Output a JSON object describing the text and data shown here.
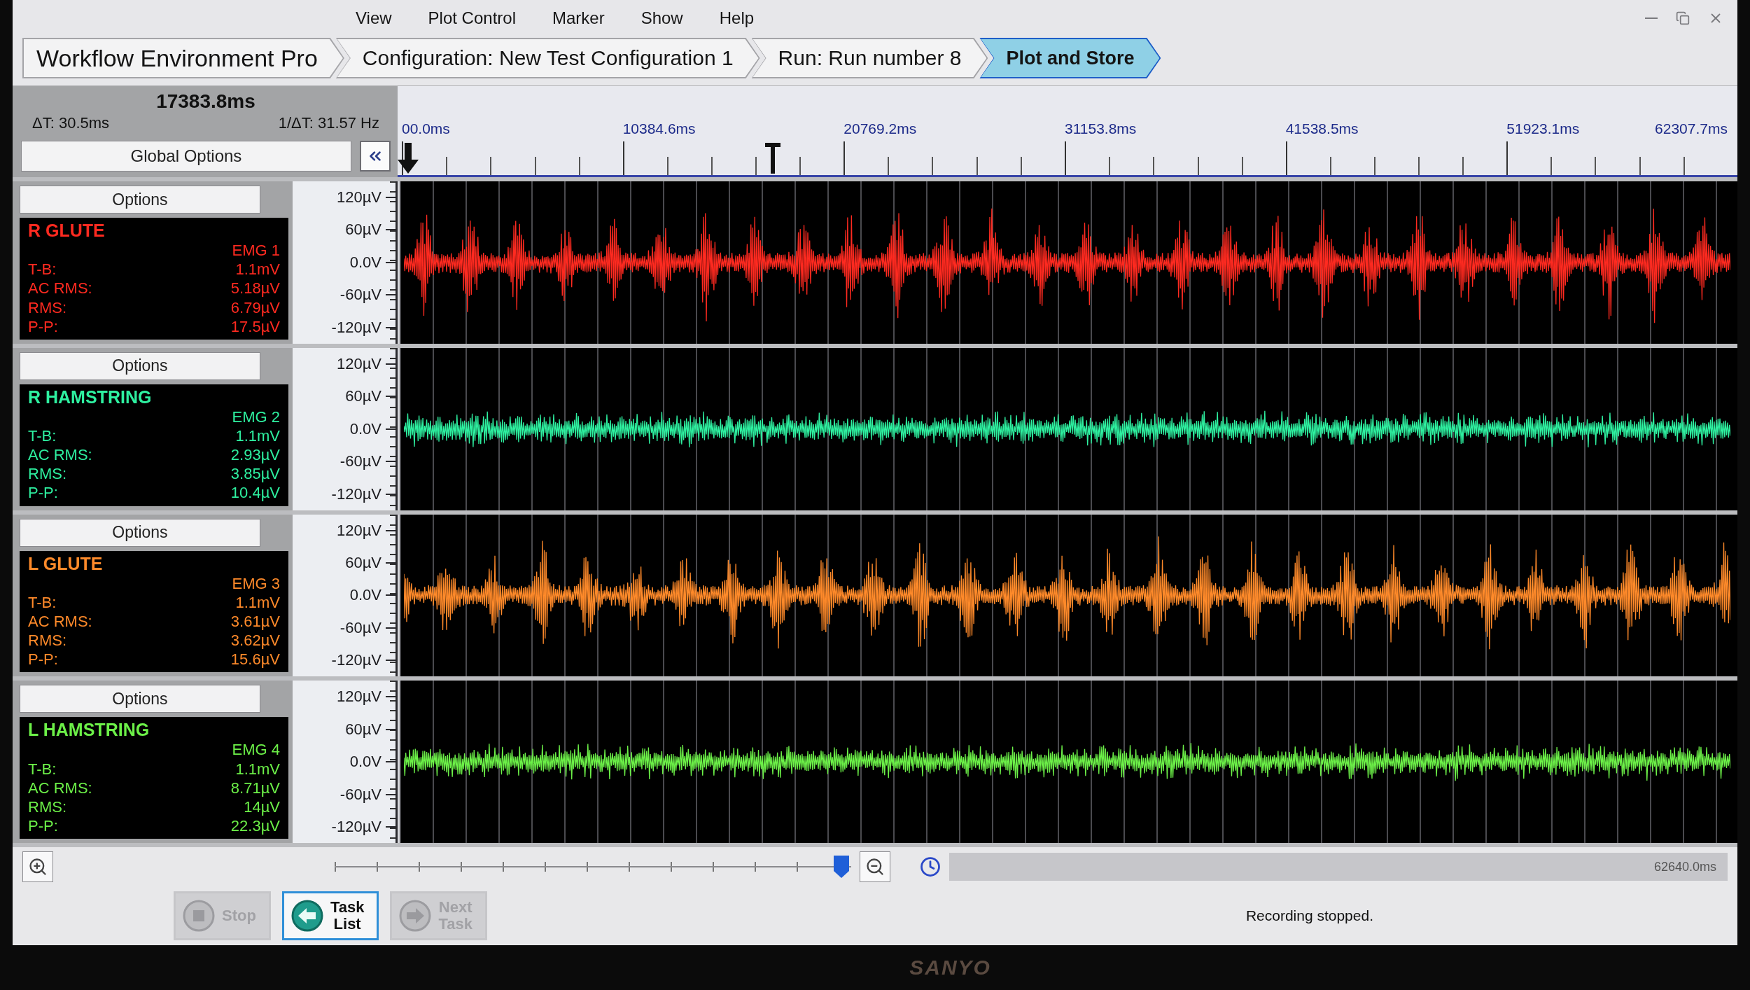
{
  "menu": [
    "View",
    "Plot Control",
    "Marker",
    "Show",
    "Help"
  ],
  "breadcrumbs": [
    {
      "label": "Workflow Environment Pro",
      "selected": false
    },
    {
      "label": "Configuration: New Test Configuration 1",
      "selected": false
    },
    {
      "label": "Run: Run number 8",
      "selected": false
    },
    {
      "label": "Plot and Store",
      "selected": true
    }
  ],
  "time_readout": {
    "time": "17383.8ms",
    "delta": "ΔT: 30.5ms",
    "frequency": "1/ΔT: 31.57 Hz",
    "global_options": "Global Options"
  },
  "ruler": {
    "labels": [
      "00.0ms",
      "10384.6ms",
      "20769.2ms",
      "31153.8ms",
      "41538.5ms",
      "51923.1ms",
      "62307.7ms"
    ],
    "cursor": {
      "level": 0.28
    }
  },
  "channels": [
    {
      "options": "Options",
      "name": "R GLUTE",
      "channel": "EMG 1",
      "color": "#ff2a20",
      "kind": "bursts",
      "stats": [
        {
          "label": "T-B:",
          "value": "1.1mV"
        },
        {
          "label": "AC RMS:",
          "value": "5.18µV"
        },
        {
          "label": "RMS:",
          "value": "6.79µV"
        },
        {
          "label": "P-P:",
          "value": "17.5µV"
        }
      ],
      "axis": [
        "120µV",
        "60µV",
        "0.0V",
        "-60µV",
        "-120µV"
      ]
    },
    {
      "options": "Options",
      "name": "R HAMSTRING",
      "channel": "EMG 2",
      "color": "#2ef0a0",
      "kind": "noise",
      "stats": [
        {
          "label": "T-B:",
          "value": "1.1mV"
        },
        {
          "label": "AC RMS:",
          "value": "2.93µV"
        },
        {
          "label": "RMS:",
          "value": "3.85µV"
        },
        {
          "label": "P-P:",
          "value": "10.4µV"
        }
      ],
      "axis": [
        "120µV",
        "60µV",
        "0.0V",
        "-60µV",
        "-120µV"
      ]
    },
    {
      "options": "Options",
      "name": "L GLUTE",
      "channel": "EMG 3",
      "color": "#ff8a2a",
      "kind": "bursts",
      "stats": [
        {
          "label": "T-B:",
          "value": "1.1mV"
        },
        {
          "label": "AC RMS:",
          "value": "3.61µV"
        },
        {
          "label": "RMS:",
          "value": "3.62µV"
        },
        {
          "label": "P-P:",
          "value": "15.6µV"
        }
      ],
      "axis": [
        "120µV",
        "60µV",
        "0.0V",
        "-60µV",
        "-120µV"
      ]
    },
    {
      "options": "Options",
      "name": "L HAMSTRING",
      "channel": "EMG 4",
      "color": "#6cf048",
      "kind": "noise",
      "stats": [
        {
          "label": "T-B:",
          "value": "1.1mV"
        },
        {
          "label": "AC RMS:",
          "value": "8.71µV"
        },
        {
          "label": "RMS:",
          "value": "14µV"
        },
        {
          "label": "P-P:",
          "value": "22.3µV"
        }
      ],
      "axis": [
        "120µV",
        "60µV",
        "0.0V",
        "-60µV",
        "-120µV"
      ]
    }
  ],
  "bottom_bar": {
    "slider": {
      "level": 1
    },
    "total_time": "62640.0ms",
    "status": "Recording stopped."
  },
  "buttons": [
    {
      "label": "Stop",
      "kind": "stop",
      "disabled": true
    },
    {
      "label": "Task List",
      "kind": "back",
      "disabled": false
    },
    {
      "label": "Next Task",
      "kind": "next",
      "disabled": true
    }
  ],
  "monitor": {
    "brand": "SANYO"
  }
}
